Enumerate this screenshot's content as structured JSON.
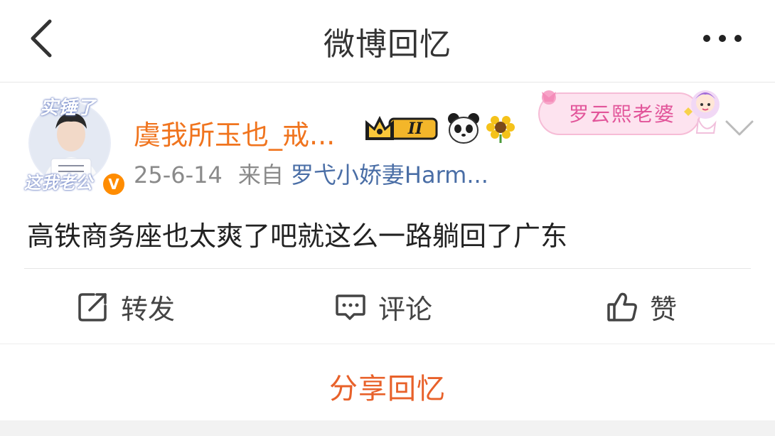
{
  "header": {
    "title": "微博回忆"
  },
  "post": {
    "avatar": {
      "frame_top_text": "实锤了",
      "frame_bottom_text": "这我老公",
      "verify_badge": "V"
    },
    "username": "虞我所玉也_戒...",
    "level_badge": "II",
    "fan_tag": "罗云熙老婆",
    "meta": {
      "date": "25-6-14",
      "from_label": "来自",
      "source": "罗弋小娇妻Harm..."
    },
    "text": "高铁商务座也太爽了吧就这么一路躺回了广东"
  },
  "actions": {
    "repost": "转发",
    "comment": "评论",
    "like": "赞"
  },
  "share": {
    "label": "分享回忆"
  },
  "colors": {
    "username": "#f0741e",
    "source_link": "#4a6ea6",
    "share_accent": "#e8612a",
    "verify_badge": "#ff8c00"
  }
}
